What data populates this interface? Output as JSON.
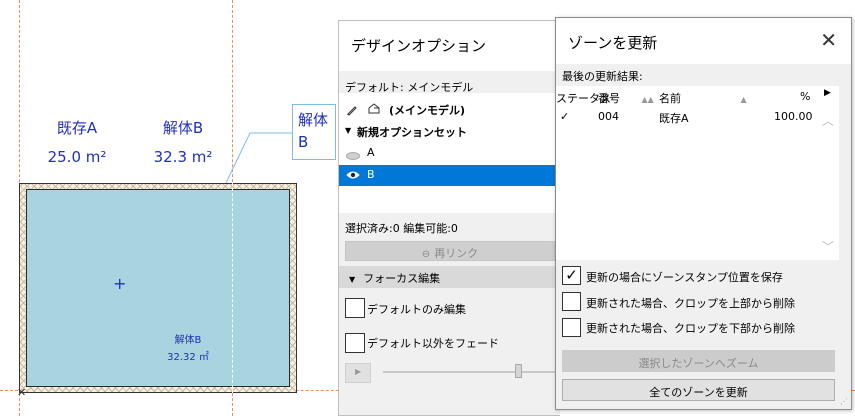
{
  "canvas": {
    "zone_a": {
      "name": "既存A",
      "area": "25.0 m²"
    },
    "zone_b": {
      "name": "解体B",
      "area": "32.3 m²"
    },
    "stamp": {
      "name": "解体B",
      "area": "32.32 ㎡"
    },
    "callout": {
      "line1": "解体",
      "line2": "B"
    },
    "zone_color": "#a7d4df",
    "label_color": "#1f2fc0",
    "guide_color": "#ef8b5a"
  },
  "design_options": {
    "title": "デザインオプション",
    "default_line": "デフォルト: メインモデル",
    "main_model": "(メインモデル)",
    "option_set": "新規オプションセット",
    "options": [
      {
        "label": "A",
        "icon": "eye-closed-icon",
        "selected": false
      },
      {
        "label": "B",
        "icon": "eye-icon",
        "selected": true
      }
    ],
    "status": "選択済み:0 編集可能:0",
    "relink_label": "再リンク",
    "focus_section": "フォーカス編集",
    "default_only": "デフォルトのみ編集",
    "fade_others": "デフォルト以外をフェード",
    "selection_color": "#0078d7"
  },
  "update_zone_dialog": {
    "title": "ゾーンを更新",
    "last_result_label": "最後の更新結果:",
    "columns": [
      "ステータス",
      "番号",
      "名前",
      "%"
    ],
    "rows": [
      {
        "status": "✓",
        "number": "004",
        "name": "既存A",
        "percent": "100.00"
      }
    ],
    "keep_stamp_label": "更新の場合にゾーンスタンプ位置を保存",
    "keep_stamp_checked": true,
    "crop_top_label": "更新された場合、クロップを上部から削除",
    "crop_top_checked": false,
    "crop_bottom_label": "更新された場合、クロップを下部から削除",
    "crop_bottom_checked": false,
    "zoom_button": "選択したゾーンへズーム",
    "update_all_button": "全てのゾーンを更新"
  }
}
